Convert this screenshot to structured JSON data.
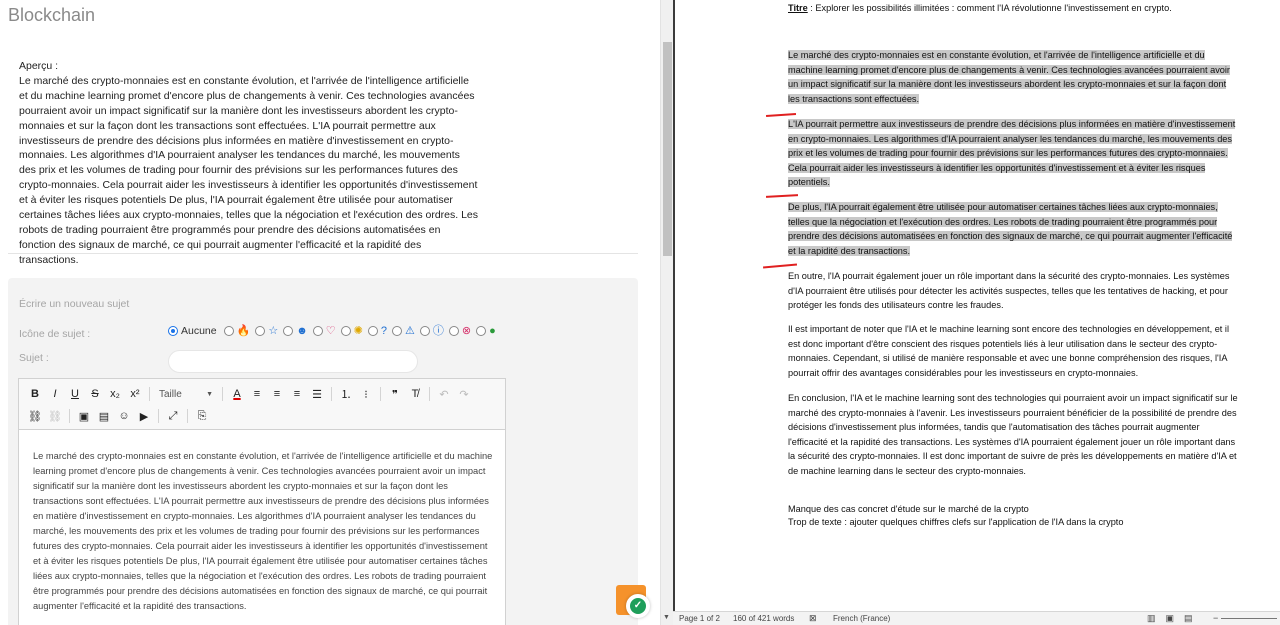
{
  "forum": {
    "title": "Blockchain",
    "preview_label": "Aperçu :",
    "preview_text": "Le marché des crypto-monnaies est en constante évolution, et l'arrivée de l'intelligence artificielle et du machine learning promet d'encore plus de changements à venir. Ces technologies avancées pourraient avoir un impact significatif sur la manière dont les investisseurs abordent les crypto-monnaies et sur la façon dont les transactions sont effectuées. L'IA pourrait permettre aux investisseurs de prendre des décisions plus informées en matière d'investissement en crypto-monnaies. Les algorithmes d'IA pourraient analyser les tendances du marché, les mouvements des prix et les volumes de trading pour fournir des prévisions sur les performances futures des crypto-monnaies. Cela pourrait aider les investisseurs à identifier les opportunités d'investissement et à éviter les risques potentiels De plus, l'IA pourrait également être utilisée pour automatiser certaines tâches liées aux crypto-monnaies, telles que la négociation et l'exécution des ordres. Les robots de trading pourraient être programmés pour prendre des décisions automatisées en fonction des signaux de marché, ce qui pourrait augmenter l'efficacité et la rapidité des transactions.",
    "compose_heading": "Écrire un nouveau sujet",
    "icon_label": "Icône de sujet :",
    "icon_none_label": "Aucune",
    "subject_label": "Sujet :",
    "subject_value": "",
    "toolbar": {
      "size_label": "Taille",
      "bold": "B",
      "italic": "I",
      "underline": "U",
      "strike": "S",
      "subscript": "x₂",
      "superscript": "x²",
      "text_color": "A",
      "quote": "❞",
      "clear_format": "T̸"
    },
    "editor_text": "Le marché des crypto-monnaies est en constante évolution, et l'arrivée de l'intelligence artificielle et du machine learning promet d'encore plus de changements à venir. Ces technologies avancées pourraient avoir un impact significatif sur la manière dont les investisseurs abordent les crypto-monnaies et sur la façon dont les transactions sont effectuées. L'IA pourrait permettre aux investisseurs de prendre des décisions plus informées en matière d'investissement en crypto-monnaies. Les algorithmes d'IA pourraient analyser les tendances du marché, les mouvements des prix et les volumes de trading pour fournir des prévisions sur les performances futures des crypto-monnaies. Cela pourrait aider les investisseurs à identifier les opportunités d'investissement et à éviter les risques potentiels De plus, l'IA pourrait également être utilisée pour automatiser certaines tâches liées aux crypto-monnaies, telles que la négociation et l'exécution des ordres. Les robots de trading pourraient être programmés pour prendre des décisions automatisées en fonction des signaux de marché, ce qui pourrait augmenter l'efficacité et la rapidité des transactions."
  },
  "document": {
    "title_label": "Titre",
    "title_text": " : Explorer les possibilités illimitées : comment l'IA révolutionne l'investissement en crypto.",
    "p1": "Le marché des crypto-monnaies est en constante évolution, et l'arrivée de l'intelligence artificielle et du machine learning promet d'encore plus de changements à venir. Ces technologies avancées pourraient avoir un impact significatif sur la manière dont les investisseurs abordent les crypto-monnaies et sur la façon dont les transactions sont effectuées.",
    "p2": "L'IA pourrait permettre aux investisseurs de prendre des décisions plus informées en matière d'investissement en crypto-monnaies. Les algorithmes d'IA pourraient analyser les tendances du marché, les mouvements des prix et les volumes de trading pour fournir des prévisions sur les performances futures des crypto-monnaies. Cela pourrait aider les investisseurs à identifier les opportunités d'investissement et à éviter les risques potentiels.",
    "p3": "De plus, l'IA pourrait également être utilisée pour automatiser certaines tâches liées aux crypto-monnaies, telles que la négociation et l'exécution des ordres. Les robots de trading pourraient être programmés pour prendre des décisions automatisées en fonction des signaux de marché, ce qui pourrait augmenter l'efficacité et la rapidité des transactions.",
    "p4": "En outre, l'IA pourrait également jouer un rôle important dans la sécurité des crypto-monnaies. Les systèmes d'IA pourraient être utilisés pour détecter les activités suspectes, telles que les tentatives de hacking, et pour protéger les fonds des utilisateurs contre les fraudes.",
    "p5": "Il est important de noter que l'IA et le machine learning sont encore des technologies en développement, et il est donc important d'être conscient des risques potentiels liés à leur utilisation dans le secteur des crypto-monnaies. Cependant, si utilisé de manière responsable et avec une bonne compréhension des risques, l'IA pourrait offrir des avantages considérables pour les investisseurs en crypto-monnaies.",
    "p6": "En conclusion, l'IA et le machine learning sont des technologies qui pourraient avoir un impact significatif sur le marché des crypto-monnaies à l'avenir. Les investisseurs pourraient bénéficier de la possibilité de prendre des décisions d'investissement plus informées, tandis que l'automatisation des tâches pourrait augmenter l'efficacité et la rapidité des transactions. Les systèmes d'IA pourraient également jouer un rôle important dans la sécurité des crypto-monnaies. Il est donc important de suivre de près les développements en matière d'IA et de machine learning dans le secteur des crypto-monnaies.",
    "note1": "Manque des cas concret d'étude sur le marché de la crypto",
    "note2": "Trop de texte : ajouter quelques chiffres clefs sur l'application de  l'IA dans la crypto"
  },
  "status": {
    "page": "Page 1 of 2",
    "words": "160 of 421 words",
    "language": "French (France)"
  },
  "colors": {
    "accent_radio": "#1a73e8",
    "highlight": "#c8c8c8",
    "badge": "#f5922b",
    "shield": "#1e9e5a",
    "annotation_mark": "#e02020"
  }
}
